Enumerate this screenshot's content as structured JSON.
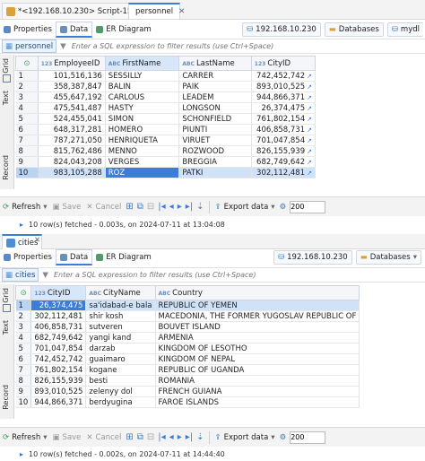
{
  "top": {
    "tabs": [
      {
        "label": "*<192.168.10.230> Script-15"
      },
      {
        "label": "personnel"
      }
    ]
  },
  "panel1": {
    "subtabs": [
      "Properties",
      "Data",
      "ER Diagram"
    ],
    "connection": "192.168.10.230",
    "databases": "Databases",
    "schema": "mydl",
    "filter_label": "personnel",
    "filter_placeholder": "Enter a SQL expression to filter results (use Ctrl+Space)",
    "side_labels": [
      "Grid",
      "Text",
      "Record"
    ],
    "columns": [
      "EmployeeID",
      "FirstName",
      "LastName",
      "CityID"
    ],
    "rows": [
      {
        "n": "1",
        "id": "101,516,136",
        "first": "SESSILLY",
        "last": "CARRER",
        "city": "742,452,742"
      },
      {
        "n": "2",
        "id": "358,387,847",
        "first": "BALIN",
        "last": "PAIK",
        "city": "893,010,525"
      },
      {
        "n": "3",
        "id": "455,647,192",
        "first": "CARLOUS",
        "last": "LEADEM",
        "city": "944,866,371"
      },
      {
        "n": "4",
        "id": "475,541,487",
        "first": "HASTY",
        "last": "LONGSON",
        "city": "26,374,475"
      },
      {
        "n": "5",
        "id": "524,455,041",
        "first": "SIMON",
        "last": "SCHONFIELD",
        "city": "761,802,154"
      },
      {
        "n": "6",
        "id": "648,317,281",
        "first": "HOMERO",
        "last": "PIUNTI",
        "city": "406,858,731"
      },
      {
        "n": "7",
        "id": "787,271,050",
        "first": "HENRIQUETA",
        "last": "VIRUET",
        "city": "701,047,854"
      },
      {
        "n": "8",
        "id": "815,762,486",
        "first": "MENNO",
        "last": "ROZWOOD",
        "city": "826,155,939"
      },
      {
        "n": "9",
        "id": "824,043,208",
        "first": "VERGES",
        "last": "BREGGIA",
        "city": "682,749,642"
      },
      {
        "n": "10",
        "id": "983,105,288",
        "first": "ROZ",
        "last": "PATKI",
        "city": "302,112,481"
      }
    ],
    "toolbar": {
      "refresh": "Refresh",
      "save": "Save",
      "cancel": "Cancel",
      "export": "Export data",
      "limit": "200"
    },
    "status": "10 row(s) fetched - 0.003s, on 2024-07-11 at 13:04:08"
  },
  "panel2": {
    "tab": "cities",
    "subtabs": [
      "Properties",
      "Data",
      "ER Diagram"
    ],
    "connection": "192.168.10.230",
    "databases": "Databases",
    "filter_label": "cities",
    "filter_placeholder": "Enter a SQL expression to filter results (use Ctrl+Space)",
    "side_labels": [
      "Grid",
      "Text",
      "Record"
    ],
    "columns": [
      "CityID",
      "CityName",
      "Country"
    ],
    "rows": [
      {
        "n": "1",
        "id": "26,374,475",
        "name": "sa'idabad-e bala",
        "country": "REPUBLIC OF YEMEN"
      },
      {
        "n": "2",
        "id": "302,112,481",
        "name": "shir kosh",
        "country": "MACEDONIA, THE FORMER YUGOSLAV REPUBLIC OF"
      },
      {
        "n": "3",
        "id": "406,858,731",
        "name": "sutveren",
        "country": "BOUVET ISLAND"
      },
      {
        "n": "4",
        "id": "682,749,642",
        "name": "yangi kand",
        "country": "ARMENIA"
      },
      {
        "n": "5",
        "id": "701,047,854",
        "name": "darzab",
        "country": "KINGDOM OF LESOTHO"
      },
      {
        "n": "6",
        "id": "742,452,742",
        "name": "guaimaro",
        "country": "KINGDOM OF NEPAL"
      },
      {
        "n": "7",
        "id": "761,802,154",
        "name": "kogane",
        "country": "REPUBLIC OF UGANDA"
      },
      {
        "n": "8",
        "id": "826,155,939",
        "name": "besti",
        "country": "ROMANIA"
      },
      {
        "n": "9",
        "id": "893,010,525",
        "name": "zelenyy dol",
        "country": "FRENCH GUIANA"
      },
      {
        "n": "10",
        "id": "944,866,371",
        "name": "berdyugina",
        "country": "FAROE ISLANDS"
      }
    ],
    "toolbar": {
      "refresh": "Refresh",
      "save": "Save",
      "cancel": "Cancel",
      "export": "Export data",
      "limit": "200"
    },
    "status": "10 row(s) fetched - 0.002s, on 2024-07-11 at 14:44:40"
  },
  "colors": {
    "accent": "#3b7dd8",
    "selection": "#cfe2f8",
    "selected_cell": "#3b7dd8"
  }
}
